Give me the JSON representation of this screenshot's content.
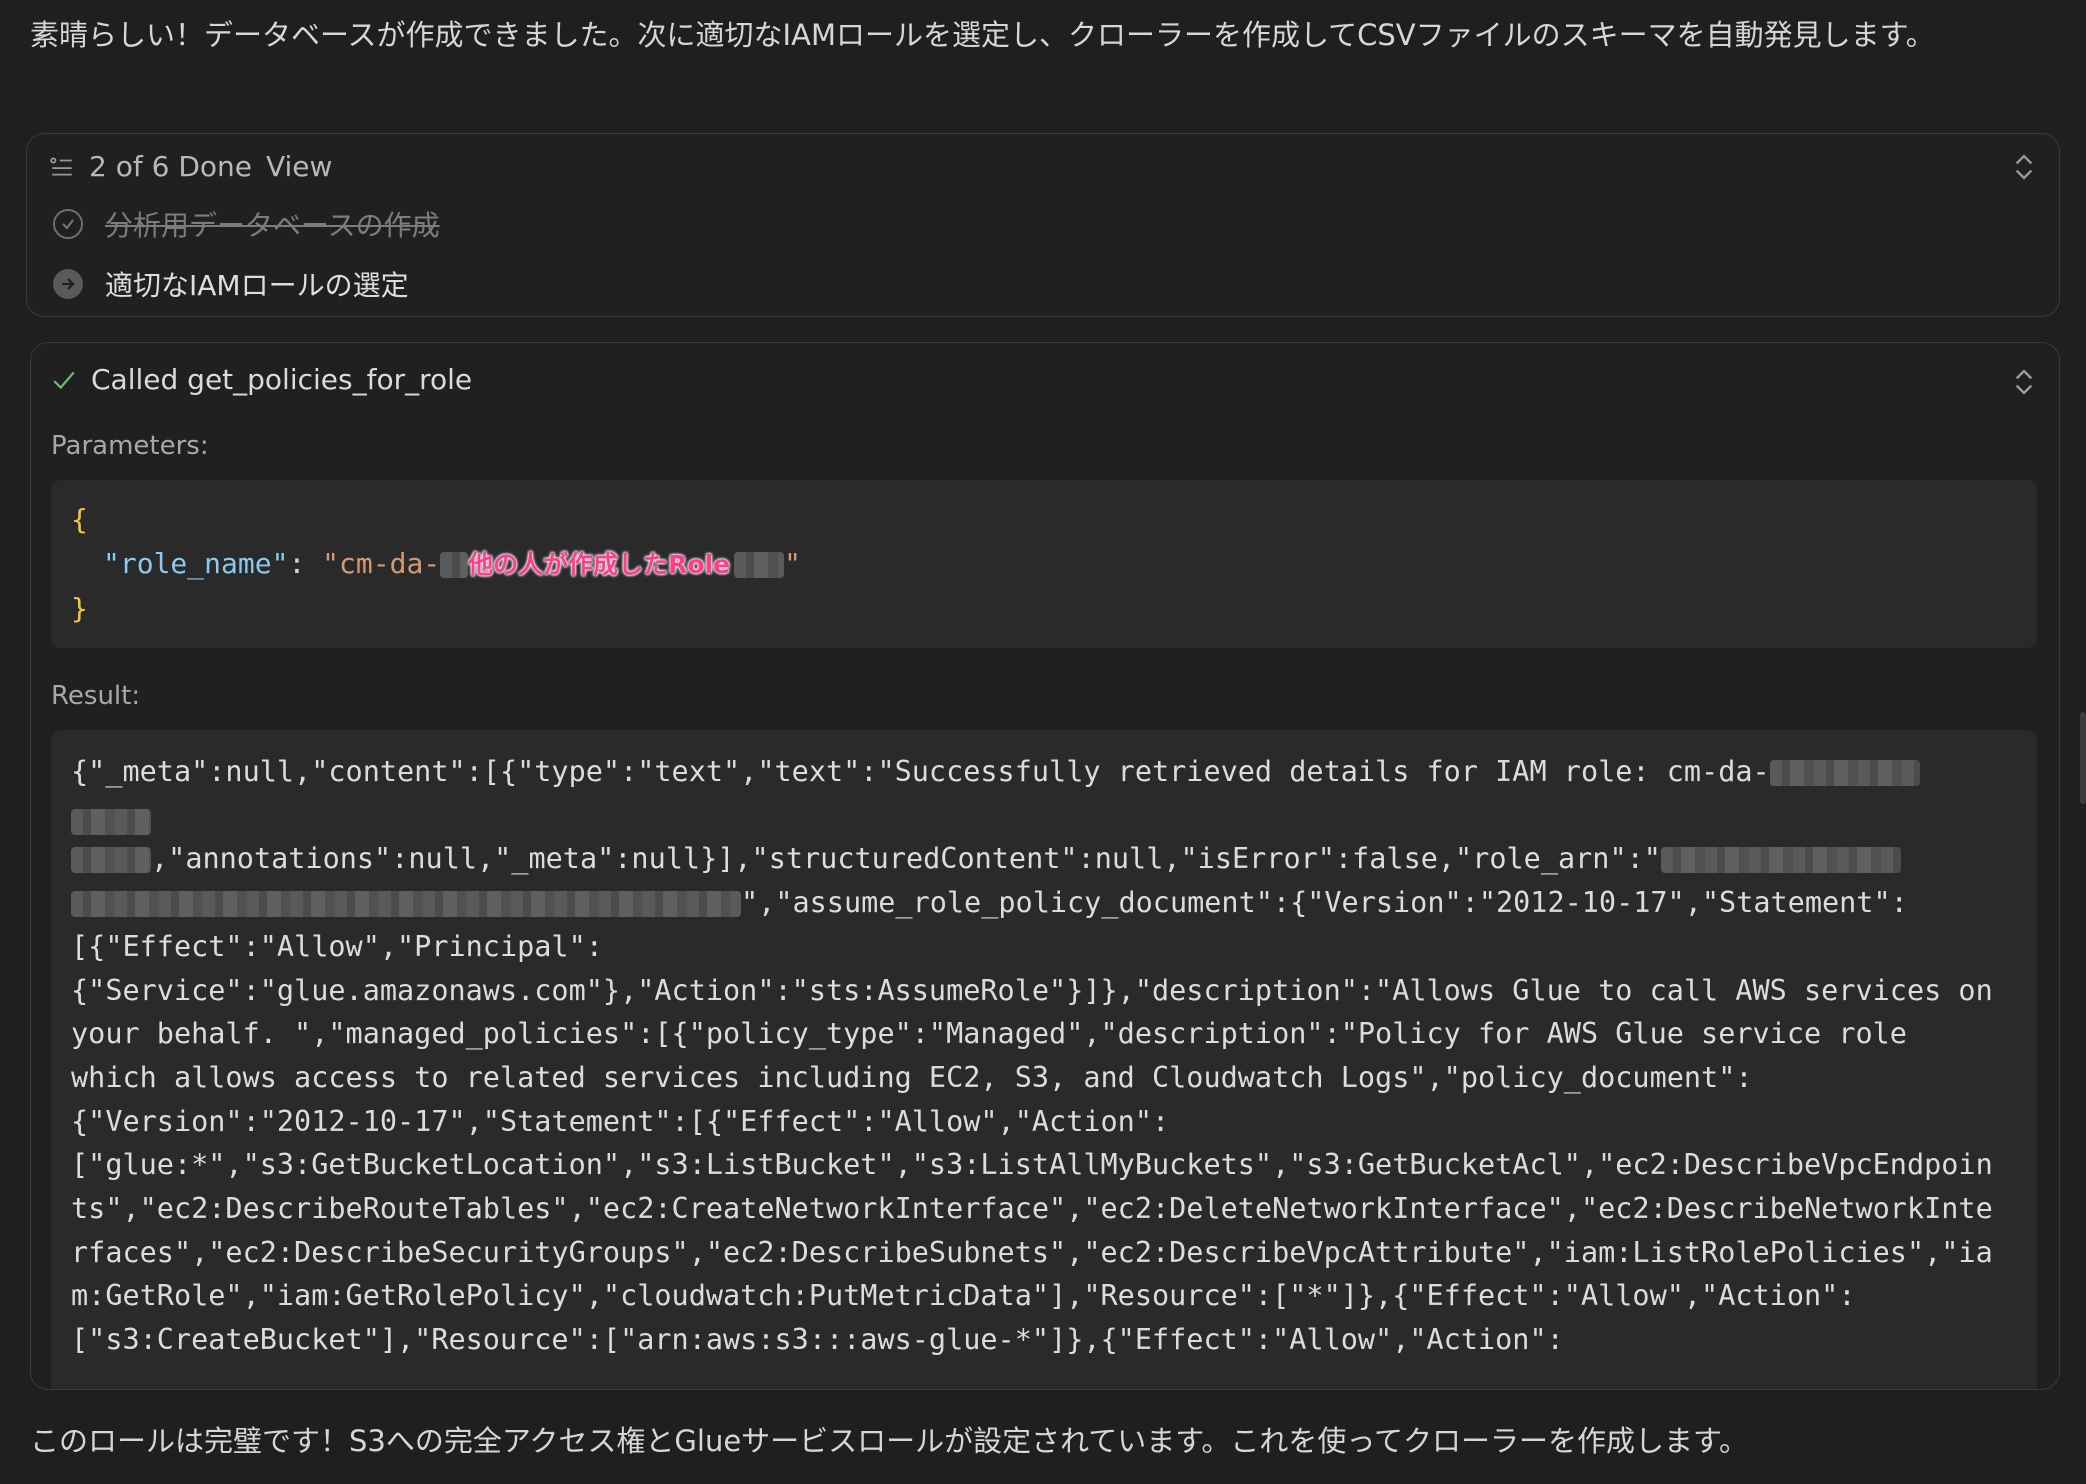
{
  "intro_text": "素晴らしい！データベースが作成できました。次に適切なIAMロールを選定し、クローラーを作成してCSVファイルのスキーマを自動発見します。",
  "todo": {
    "progress": "2 of 6 Done",
    "view_label": "View",
    "items": [
      {
        "label": "分析用データベースの作成",
        "status": "done"
      },
      {
        "label": "適切なIAMロールの選定",
        "status": "in_progress"
      }
    ]
  },
  "tool_call": {
    "title": "Called get_policies_for_role",
    "parameters_label": "Parameters:",
    "param_key": "\"role_name\"",
    "param_value_prefix": "\"cm-da-",
    "param_value_suffix": "\"",
    "annotation": "他の人が作成したRole",
    "result_label": "Result:",
    "result_lines": [
      "{\"_meta\":null,\"content\":[{\"type\":\"text\",\"text\":\"Successfully retrieved details for IAM role: cm-da-",
      ",\"annotations\":null,\"_meta\":null}],\"structuredContent\":null,\"isError\":false,\"role_arn\":\"",
      "\",\"assume_role_policy_document\":{\"Version\":\"2012-10-17\",\"Statement\":",
      "[{\"Effect\":\"Allow\",\"Principal\":",
      "{\"Service\":\"glue.amazonaws.com\"},\"Action\":\"sts:AssumeRole\"}]},\"description\":\"Allows Glue to call AWS services on",
      "your behalf. \",\"managed_policies\":[{\"policy_type\":\"Managed\",\"description\":\"Policy for AWS Glue service role",
      "which allows access to related services including EC2, S3, and Cloudwatch Logs\",\"policy_document\":",
      "{\"Version\":\"2012-10-17\",\"Statement\":[{\"Effect\":\"Allow\",\"Action\":",
      "[\"glue:*\",\"s3:GetBucketLocation\",\"s3:ListBucket\",\"s3:ListAllMyBuckets\",\"s3:GetBucketAcl\",\"ec2:DescribeVpcEndpoin",
      "ts\",\"ec2:DescribeRouteTables\",\"ec2:CreateNetworkInterface\",\"ec2:DeleteNetworkInterface\",\"ec2:DescribeNetworkInte",
      "rfaces\",\"ec2:DescribeSecurityGroups\",\"ec2:DescribeSubnets\",\"ec2:DescribeVpcAttribute\",\"iam:ListRolePolicies\",\"ia",
      "m:GetRole\",\"iam:GetRolePolicy\",\"cloudwatch:PutMetricData\"],\"Resource\":[\"*\"]},{\"Effect\":\"Allow\",\"Action\":",
      "[\"s3:CreateBucket\"],\"Resource\":[\"arn:aws:s3:::aws-glue-*\"]},{\"Effect\":\"Allow\",\"Action\":"
    ]
  },
  "outro_text": "このロールは完璧です！S3への完全アクセス権とGlueサービスロールが設定されています。これを使ってクローラーを作成します。"
}
